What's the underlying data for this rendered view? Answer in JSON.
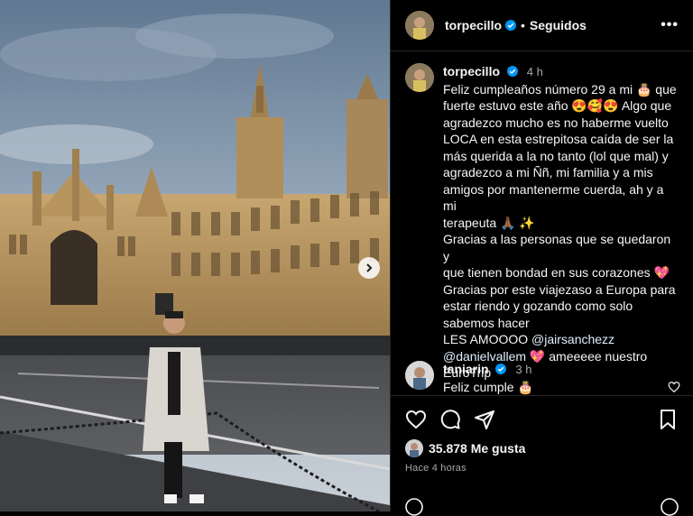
{
  "post": {
    "username": "torpecillo",
    "follow_status": "Seguidos",
    "more_label": "•••",
    "separator": "•"
  },
  "caption": {
    "username": "torpecillo",
    "time": "4 h",
    "lines": [
      "Feliz cumpleaños número 29 a mi 🎂 que",
      "fuerte estuvo este año 😍🥰😍 Algo que",
      "agradezco mucho es no haberme vuelto",
      "LOCA en esta estrepitosa caída de ser la",
      "más querida a la no tanto (lol que mal) y",
      "agradezco a mi Ññ, mi familia y a mis",
      "amigos por mantenerme cuerda, ah y a mi",
      "terapeuta 🙏🏾 ✨",
      "Gracias a las personas que se quedaron y",
      "que tienen bondad en sus corazones 💖",
      "Gracias por este viajezaso a Europa para",
      "estar riendo y gozando como solo",
      "sabemos hacer"
    ],
    "line_les": "LES AMOOOO ",
    "mention1": "@jairsanchezz",
    "mention2": "@danielvallem",
    "line_after_mention2": " 💖 ameeeee nuestro",
    "last_line": "EuroTrip"
  },
  "comment": {
    "username": "taniarin",
    "time": "3 h",
    "text": "Feliz cumple 🎂"
  },
  "likes": {
    "count_text": "35.878 Me gusta",
    "time_ago": "Hace 4 horas"
  },
  "colors": {
    "verified": "#0095f6",
    "background": "#000000",
    "border": "#262626",
    "muted": "#a8a8a8"
  },
  "icons": {
    "like": "heart-icon",
    "comment": "comment-icon",
    "share": "send-icon",
    "save": "bookmark-icon",
    "next": "chevron-right-icon"
  }
}
